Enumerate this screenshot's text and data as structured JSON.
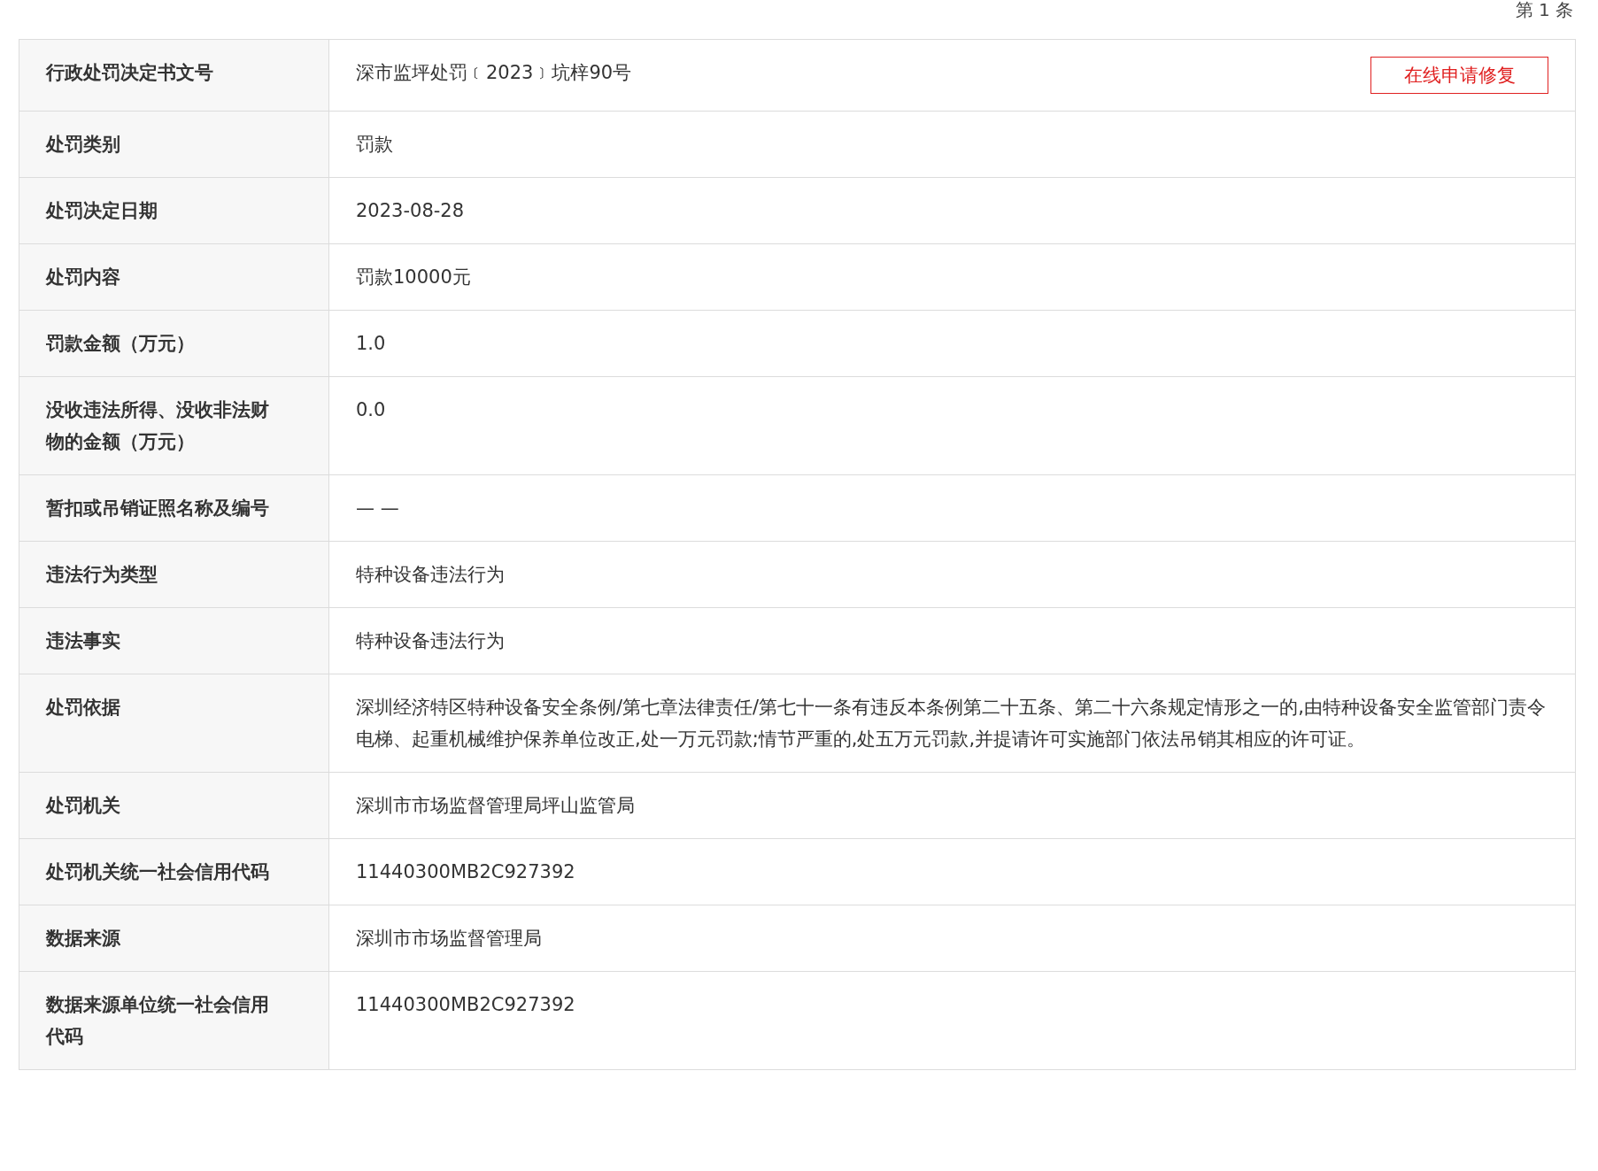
{
  "record_counter": "第 1 条",
  "repair_button": {
    "label": "在线申请修复"
  },
  "rows": [
    {
      "label": "行政处罚决定书文号",
      "value": "深市监坪处罚﹝2023﹞坑梓90号"
    },
    {
      "label": "处罚类别",
      "value": "罚款"
    },
    {
      "label": "处罚决定日期",
      "value": "2023-08-28"
    },
    {
      "label": "处罚内容",
      "value": "罚款10000元"
    },
    {
      "label": "罚款金额（万元）",
      "value": "1.0"
    },
    {
      "label": "没收违法所得、没收非法财物的金额（万元）",
      "value": "0.0"
    },
    {
      "label": "暂扣或吊销证照名称及编号",
      "value": "— —"
    },
    {
      "label": "违法行为类型",
      "value": "特种设备违法行为"
    },
    {
      "label": "违法事实",
      "value": "特种设备违法行为"
    },
    {
      "label": "处罚依据",
      "value": "深圳经济特区特种设备安全条例/第七章法律责任/第七十一条有违反本条例第二十五条、第二十六条规定情形之一的,由特种设备安全监管部门责令电梯、起重机械维护保养单位改正,处一万元罚款;情节严重的,处五万元罚款,并提请许可实施部门依法吊销其相应的许可证。"
    },
    {
      "label": "处罚机关",
      "value": "深圳市市场监督管理局坪山监管局"
    },
    {
      "label": "处罚机关统一社会信用代码",
      "value": "11440300MB2C927392"
    },
    {
      "label": "数据来源",
      "value": "深圳市市场监督管理局"
    },
    {
      "label": "数据来源单位统一社会信用代码",
      "value": "11440300MB2C927392"
    }
  ]
}
